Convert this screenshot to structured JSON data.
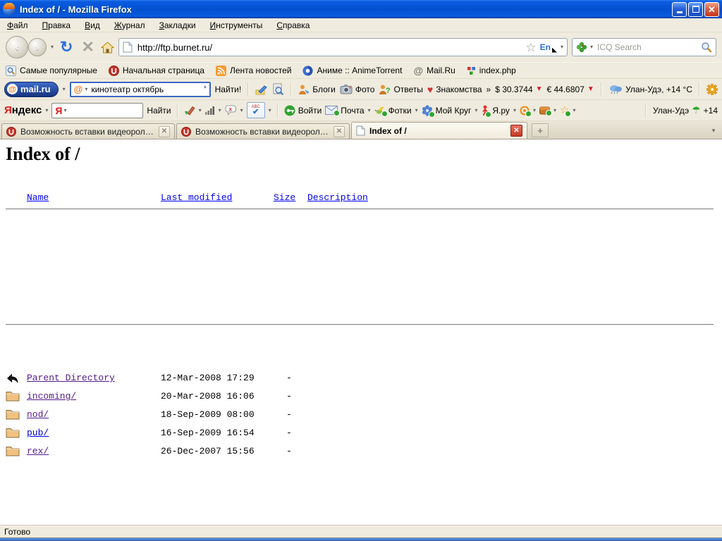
{
  "window": {
    "title": "Index of / - Mozilla Firefox",
    "controls": {
      "minimize": "minimize",
      "restore": "restore",
      "close": "close"
    }
  },
  "menubar": {
    "items": [
      "Файл",
      "Правка",
      "Вид",
      "Журнал",
      "Закладки",
      "Инструменты",
      "Справка"
    ]
  },
  "navbar": {
    "url": "http://ftp.burnet.ru/",
    "lang_badge": "En",
    "icq_search_placeholder": "ICQ Search",
    "icons": [
      "back-icon",
      "forward-icon",
      "reload-icon",
      "stop-icon",
      "home-icon",
      "page-favicon",
      "bookmark-star-icon",
      "search-engine-clover-icon",
      "search-go-icon"
    ]
  },
  "bookmarks_bar": {
    "items": [
      {
        "label": "Самые популярные",
        "icon": "search-icon"
      },
      {
        "label": "Начальная страница",
        "icon": "ucoz-icon"
      },
      {
        "label": "Лента новостей",
        "icon": "rss-icon"
      },
      {
        "label": "Аниме :: AnimeTorrent",
        "icon": "anime-globe-icon"
      },
      {
        "label": "Mail.Ru",
        "icon": "at-icon"
      },
      {
        "label": "index.php",
        "icon": "php-tiles-icon"
      }
    ]
  },
  "mailru_toolbar": {
    "logo_at": "@",
    "logo_text": "mail.ru",
    "search_value": "кинотеатр октябрь",
    "find_label": "Найти!",
    "links": [
      {
        "label": "Блоги",
        "icon": "blogger-icon"
      },
      {
        "label": "Фото",
        "icon": "camera-icon"
      },
      {
        "label": "Ответы",
        "icon": "answers-icon"
      },
      {
        "label": "Знакомства",
        "icon": "heart-icon"
      }
    ],
    "overflow_chevron": "»",
    "usd_rate": "$ 30.3744",
    "eur_rate": "€ 44.6807",
    "weather": "Улан-Удэ, +14 °C",
    "icons": [
      "compose-icon",
      "preview-icon",
      "weather-cloud-icon",
      "gear-icon"
    ]
  },
  "yandex_toolbar": {
    "logo": "Яндекс",
    "input_badge": "Я",
    "find_label": "Найти",
    "spellcheck_abc": "ABC",
    "login_label": "Войти",
    "mail_label": "Почта",
    "fotki_label": "Фотки",
    "moikrug_label": "Мой Круг",
    "yaru_label": "Я.ру",
    "weather_city": "Улан-Удэ",
    "weather_temp": "+14",
    "icons": [
      "edit-icon",
      "traffic-bars-icon",
      "comments-off-icon",
      "spellcheck-icon",
      "key-icon",
      "mail-envelope-icon",
      "hummingbird-icon",
      "flower-icon",
      "person-icon",
      "spiral-icon",
      "wallet-icon",
      "star-icon",
      "umbrella-icon"
    ]
  },
  "tabbar": {
    "tabs": [
      {
        "title": "Возможность вставки видеороликов ...",
        "active": false
      },
      {
        "title": "Возможность вставки видеороликов ...",
        "active": false
      },
      {
        "title": "Index of /",
        "active": true
      }
    ],
    "new_tab_label": "+"
  },
  "content": {
    "heading": "Index of /",
    "columns": {
      "name": "Name",
      "modified": "Last modified",
      "size": "Size",
      "description": "Description"
    },
    "rows": [
      {
        "icon": "parent-dir-icon",
        "name": "Parent Directory",
        "modified": "12-Mar-2008 17:29",
        "size": "-",
        "description": "",
        "visited": true
      },
      {
        "icon": "folder-icon",
        "name": "incoming/",
        "modified": "20-Mar-2008 16:06",
        "size": "-",
        "description": "",
        "visited": true
      },
      {
        "icon": "folder-icon",
        "name": "nod/",
        "modified": "18-Sep-2009 08:00",
        "size": "-",
        "description": "",
        "visited": true
      },
      {
        "icon": "folder-icon",
        "name": "pub/",
        "modified": "16-Sep-2009 16:54",
        "size": "-",
        "description": "",
        "visited": false
      },
      {
        "icon": "folder-icon",
        "name": "rex/",
        "modified": "26-Dec-2007 15:56",
        "size": "-",
        "description": "",
        "visited": true
      }
    ]
  },
  "statusbar": {
    "text": "Готово"
  }
}
